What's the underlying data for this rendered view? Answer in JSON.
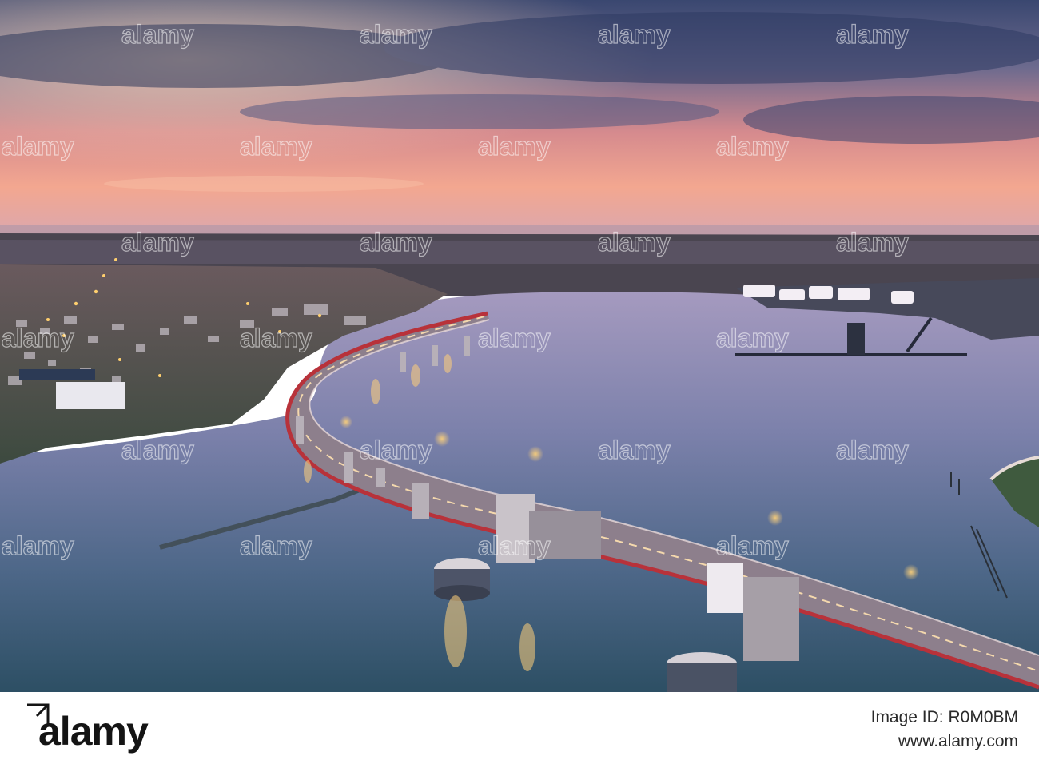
{
  "watermark": {
    "brand": "alamy"
  },
  "footer": {
    "logo_text": "alamy",
    "image_id_label": "Image ID: R0M0BM",
    "site_label": "www.alamy.com"
  },
  "colors": {
    "sky_top": "#3d4a6e",
    "sky_glow": "#f2a090",
    "water": "#5d6f98",
    "bridge_deck": "#7a6e78",
    "bridge_rail": "#b8323a",
    "footer_bg": "#ffffff"
  }
}
